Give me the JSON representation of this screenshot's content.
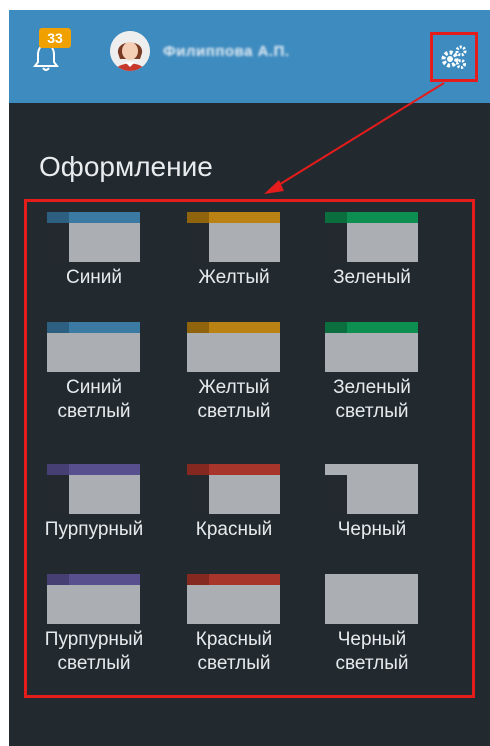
{
  "header": {
    "notifications_count": "33",
    "username": "Филиппова А.П."
  },
  "section_title": "Оформление",
  "themes": [
    {
      "line1": "Синий",
      "line2": "",
      "bar_color": "#3a7aa3",
      "corner_color": "#2d5f80",
      "has_sidebar": true
    },
    {
      "line1": "Желтый",
      "line2": "",
      "bar_color": "#b98213",
      "corner_color": "#8f640d",
      "has_sidebar": true
    },
    {
      "line1": "Зеленый",
      "line2": "",
      "bar_color": "#0e8f52",
      "corner_color": "#0b6e3f",
      "has_sidebar": true
    },
    {
      "line1": "Синий",
      "line2": "светлый",
      "bar_color": "#3a7aa3",
      "corner_color": "#2d5f80",
      "has_sidebar": false
    },
    {
      "line1": "Желтый",
      "line2": "светлый",
      "bar_color": "#b98213",
      "corner_color": "#8f640d",
      "has_sidebar": false
    },
    {
      "line1": "Зеленый",
      "line2": "светлый",
      "bar_color": "#0e8f52",
      "corner_color": "#0b6e3f",
      "has_sidebar": false
    },
    {
      "line1": "Пурпурный",
      "line2": "",
      "bar_color": "#574f8e",
      "corner_color": "#463f73",
      "has_sidebar": true
    },
    {
      "line1": "Красный",
      "line2": "",
      "bar_color": "#a8352c",
      "corner_color": "#852820",
      "has_sidebar": true
    },
    {
      "line1": "Черный",
      "line2": "",
      "bar_color": "#abaeb2",
      "corner_color": "#abaeb2",
      "has_sidebar": true
    },
    {
      "line1": "Пурпурный",
      "line2": "светлый",
      "bar_color": "#574f8e",
      "corner_color": "#463f73",
      "has_sidebar": false
    },
    {
      "line1": "Красный",
      "line2": "светлый",
      "bar_color": "#a8352c",
      "corner_color": "#852820",
      "has_sidebar": false
    },
    {
      "line1": "Черный",
      "line2": "светлый",
      "bar_color": "#abaeb2",
      "corner_color": "#abaeb2",
      "has_sidebar": false
    }
  ],
  "colors": {
    "header_bg": "#3d8bbf",
    "panel_bg": "#232a2f",
    "annotation_red": "#e41c1c",
    "badge": "#f0a100"
  }
}
